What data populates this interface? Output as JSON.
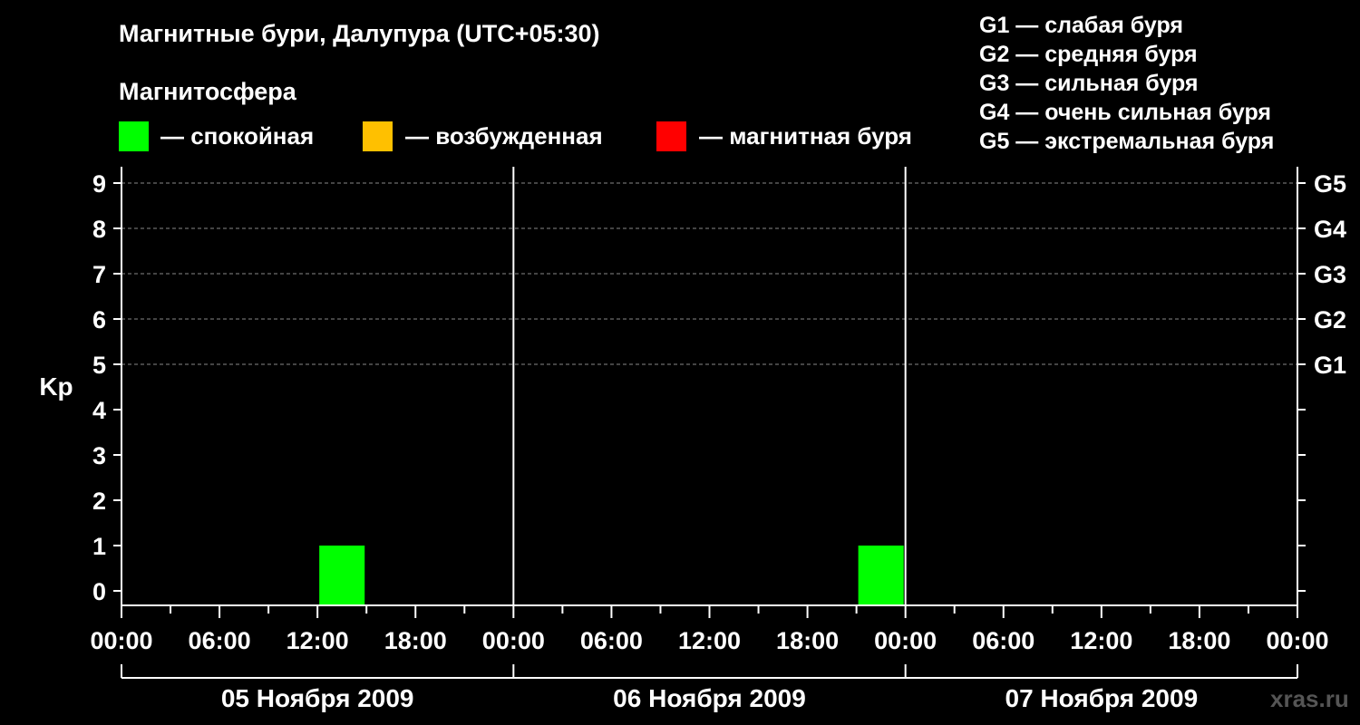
{
  "title": "Магнитные бури, Далупура (UTC+05:30)",
  "magnetosphere_label": "Магнитосфера",
  "legend": [
    {
      "color": "#00ff00",
      "text": "— спокойная"
    },
    {
      "color": "#ffc000",
      "text": "— возбужденная"
    },
    {
      "color": "#ff0000",
      "text": "— магнитная буря"
    }
  ],
  "g_legend": [
    "G1 — слабая буря",
    "G2 — средняя буря",
    "G3 — сильная буря",
    "G4 — очень сильная буря",
    "G5 — экстремальная буря"
  ],
  "watermark": "xras.ru",
  "chart_data": {
    "type": "bar",
    "ylabel": "Kp",
    "ylim": [
      0,
      9
    ],
    "yticks": [
      0,
      1,
      2,
      3,
      4,
      5,
      6,
      7,
      8,
      9
    ],
    "right_axis_labels": [
      {
        "kp": 5,
        "label": "G1"
      },
      {
        "kp": 6,
        "label": "G2"
      },
      {
        "kp": 7,
        "label": "G3"
      },
      {
        "kp": 8,
        "label": "G4"
      },
      {
        "kp": 9,
        "label": "G5"
      }
    ],
    "grid": "dashed horizontal at Kp 5-9",
    "days": [
      "05 Ноября 2009",
      "06 Ноября 2009",
      "07 Ноября 2009"
    ],
    "xtick_labels": [
      "00:00",
      "06:00",
      "12:00",
      "18:00",
      "00:00",
      "06:00",
      "12:00",
      "18:00",
      "00:00",
      "06:00",
      "12:00",
      "18:00",
      "00:00"
    ],
    "interval_hours": 3,
    "bars": [
      {
        "day": 0,
        "start_hour": 12,
        "kp": 1,
        "color": "#00ff00"
      },
      {
        "day": 1,
        "start_hour": 21,
        "kp": 1,
        "color": "#00ff00"
      }
    ]
  }
}
